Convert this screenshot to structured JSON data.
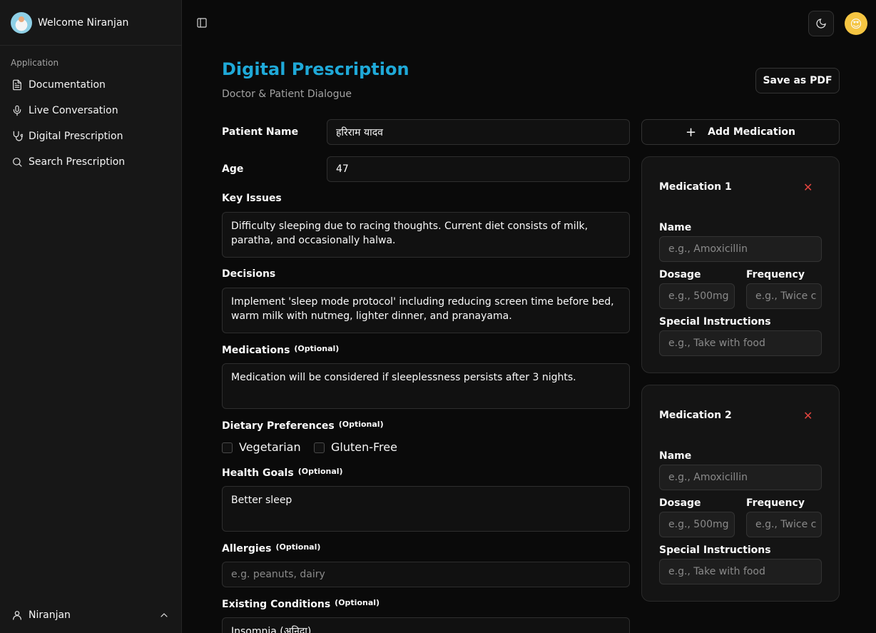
{
  "sidebar": {
    "welcome": "Welcome Niranjan",
    "group_label": "Application",
    "items": [
      {
        "label": "Documentation",
        "icon": "file-text-icon"
      },
      {
        "label": "Live Conversation",
        "icon": "mic-icon"
      },
      {
        "label": "Digital Prescription",
        "icon": "stethoscope-icon"
      },
      {
        "label": "Search Prescription",
        "icon": "search-icon"
      }
    ],
    "footer_user": "Niranjan"
  },
  "header": {
    "title": "Digital Prescription",
    "subtitle": "Doctor & Patient Dialogue",
    "save_pdf": "Save as PDF"
  },
  "form": {
    "patient_name_label": "Patient Name",
    "patient_name_value": "हरिराम यादव",
    "age_label": "Age",
    "age_value": "47",
    "key_issues_label": "Key Issues",
    "key_issues_value": "Difficulty sleeping due to racing thoughts. Current diet consists of milk, paratha, and occasionally halwa.",
    "decisions_label": "Decisions",
    "decisions_value": "Implement 'sleep mode protocol' including reducing screen time before bed, warm milk with nutmeg, lighter dinner, and pranayama.",
    "medications_label": "Medications",
    "medications_value": "Medication will be considered if sleeplessness persists after 3 nights.",
    "optional": "(Optional)",
    "dietary_label": "Dietary Preferences",
    "diet_options": [
      "Vegetarian",
      "Gluten-Free"
    ],
    "health_goals_label": "Health Goals",
    "health_goals_value": "Better sleep",
    "allergies_label": "Allergies",
    "allergies_placeholder": "e.g. peanuts, dairy",
    "conditions_label": "Existing Conditions",
    "conditions_value": "Insomnia (अनिद्रा)"
  },
  "medication_panel": {
    "add_label": "Add Medication",
    "cards": [
      {
        "title": "Medication 1"
      },
      {
        "title": "Medication 2"
      }
    ],
    "name_label": "Name",
    "name_placeholder": "e.g., Amoxicillin",
    "dosage_label": "Dosage",
    "dosage_placeholder": "e.g., 500mg",
    "frequency_label": "Frequency",
    "frequency_placeholder": "e.g., Twice c",
    "instructions_label": "Special Instructions",
    "instructions_placeholder": "e.g., Take with food"
  },
  "colors": {
    "accent": "#1fa9d8",
    "danger": "#e0443e",
    "background": "#0a0a0a",
    "sidebar": "#171717"
  }
}
